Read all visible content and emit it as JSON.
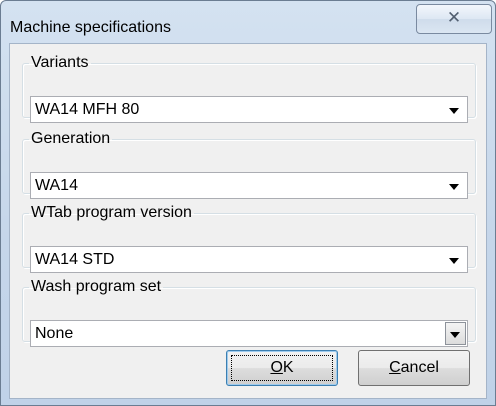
{
  "window": {
    "title": "Machine specifications",
    "close_glyph": "✕"
  },
  "groups": [
    {
      "label": "Variants",
      "value": "WA14 MFH 80"
    },
    {
      "label": "Generation",
      "value": "WA14"
    },
    {
      "label": "WTab program version",
      "value": "WA14 STD"
    },
    {
      "label": "Wash program set",
      "value": "None"
    }
  ],
  "buttons": {
    "ok": {
      "accel": "O",
      "rest": "K"
    },
    "cancel": {
      "accel": "C",
      "rest": "ancel"
    }
  }
}
